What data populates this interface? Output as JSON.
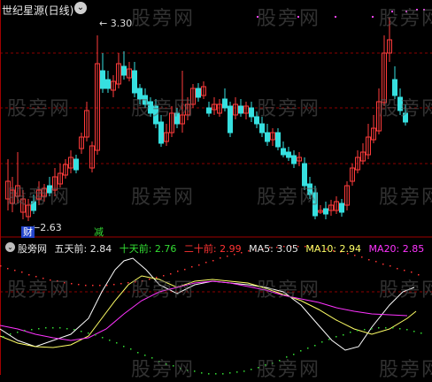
{
  "header": {
    "title": "世纪星源(日线)",
    "menu_icon": "chevron-down-icon"
  },
  "watermark": "股旁网",
  "price_chart": {
    "high_label": "3.30",
    "low_label": "2.63",
    "badge_cai": "财",
    "badge_jian": "减",
    "colors": {
      "up": "#ff3b3b",
      "down": "#36e0e0",
      "grid": "#8b0000"
    }
  },
  "indicator": {
    "name": "股旁网",
    "items": [
      {
        "label": "五天前: 2.84",
        "color": "#e8e8e8"
      },
      {
        "label": "十天前: 2.76",
        "color": "#33dd33"
      },
      {
        "label": "二十前: 2.99",
        "color": "#ff3333"
      },
      {
        "label": "MA5: 3.05",
        "color": "#e8e8e8"
      },
      {
        "label": "MA10: 2.94",
        "color": "#ffff66"
      },
      {
        "label": "MA20: 2.85",
        "color": "#ff33ff"
      }
    ]
  }
}
